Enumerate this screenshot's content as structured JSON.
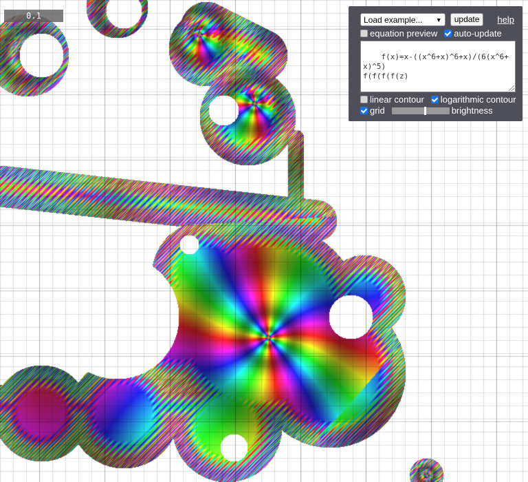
{
  "scale": {
    "label": "0.1"
  },
  "panel": {
    "example_select": "Load example...",
    "update_label": "update",
    "help_label": "help",
    "equation_preview": {
      "label": "equation preview",
      "checked": false
    },
    "auto_update": {
      "label": "auto-update",
      "checked": true
    },
    "equation_text": "f(x)=x-((x^6+x)^6+x)/(6(x^6+x)^5)\nf(f(f(f(z)",
    "linear_contour": {
      "label": "linear contour",
      "checked": false
    },
    "logarithmic_contour": {
      "label": "logarithmic contour",
      "checked": true
    },
    "grid": {
      "label": "grid",
      "checked": true
    },
    "brightness": {
      "label": "brightness",
      "value": 0.58
    }
  }
}
